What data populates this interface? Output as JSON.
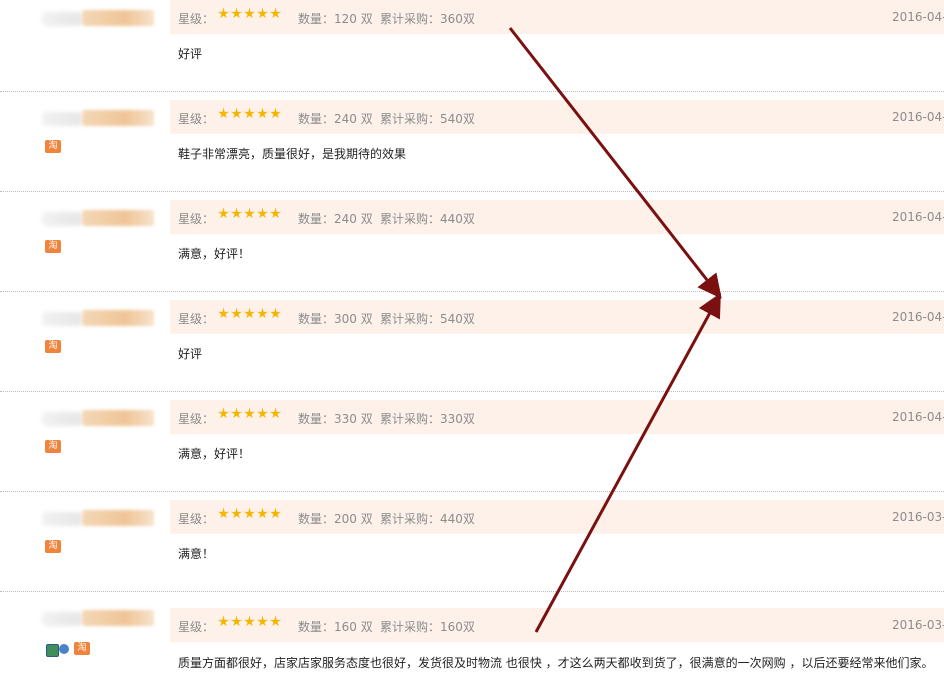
{
  "labels": {
    "star_prefix": "星级：",
    "qty_prefix": "数量：",
    "cum_prefix": "累计采购："
  },
  "shop_badge": "淘",
  "rating_icon": "star-icon",
  "colors": {
    "meta_bg": "#fdf1ea",
    "star": "#f5b400",
    "arrow": "#7a1010",
    "badge": "#f0843c"
  },
  "reviews": [
    {
      "qty": "120 双",
      "cum": "360双",
      "date": "2016-04-",
      "content": "好评",
      "stars": 5
    },
    {
      "qty": "240 双",
      "cum": "540双",
      "date": "2016-04-",
      "content": "鞋子非常漂亮，质量很好，是我期待的效果",
      "stars": 5
    },
    {
      "qty": "240 双",
      "cum": "440双",
      "date": "2016-04-",
      "content": "满意，好评！",
      "stars": 5
    },
    {
      "qty": "300 双",
      "cum": "540双",
      "date": "2016-04-",
      "content": "好评",
      "stars": 5
    },
    {
      "qty": "330 双",
      "cum": "330双",
      "date": "2016-04-",
      "content": "满意，好评！",
      "stars": 5
    },
    {
      "qty": "200 双",
      "cum": "440双",
      "date": "2016-03-",
      "content": "满意！",
      "stars": 5
    },
    {
      "qty": "160 双",
      "cum": "160双",
      "date": "2016-03-",
      "content": "质量方面都很好，店家店家服务态度也很好，发货很及时物流 也很快 ，才这么两天都收到货了，很满意的一次网购 ，以后还要经常来他们家。",
      "stars": 5
    }
  ]
}
